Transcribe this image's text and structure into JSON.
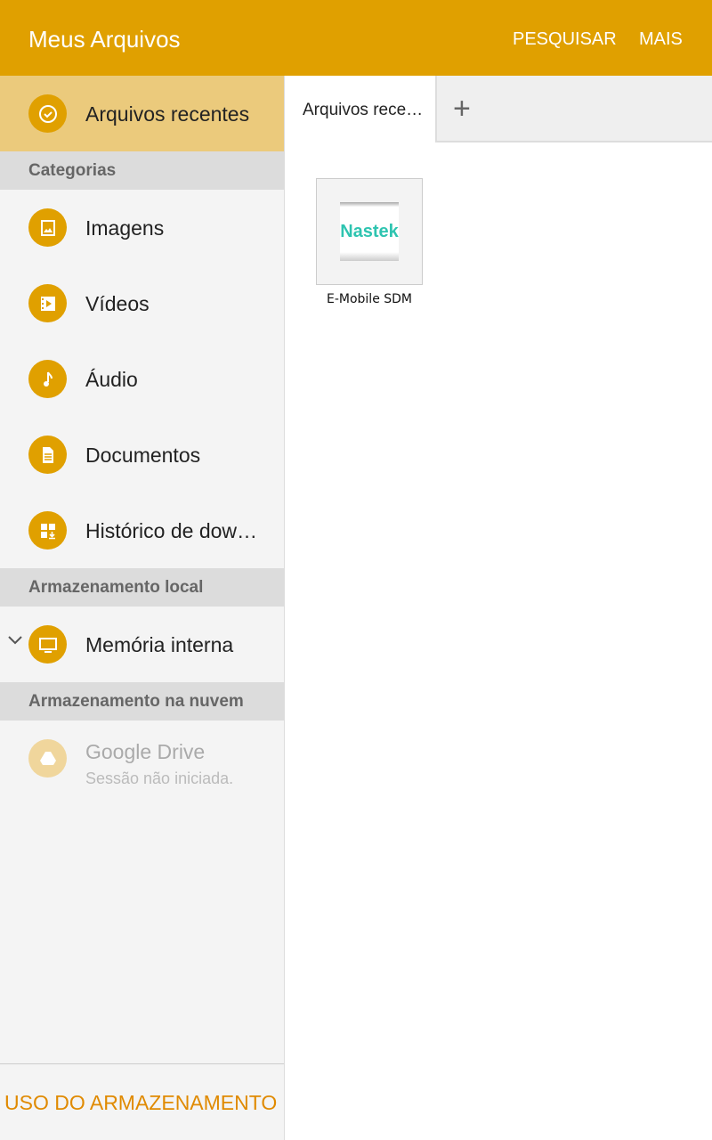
{
  "header": {
    "title": "Meus Arquivos",
    "search": "PESQUISAR",
    "more": "MAIS"
  },
  "sidebar": {
    "recent": "Arquivos recentes",
    "categories_header": "Categorias",
    "categories": [
      "Imagens",
      "Vídeos",
      "Áudio",
      "Documentos",
      "Histórico de dow…"
    ],
    "local_header": "Armazenamento local",
    "internal": "Memória interna",
    "cloud_header": "Armazenamento na nuvem",
    "drive": "Google Drive",
    "drive_status": "Sessão não iniciada.",
    "storage_usage": "USO DO ARMAZENAMENTO"
  },
  "main": {
    "tab": "Arquivos rece…",
    "files": [
      {
        "name": "E-Mobile SDM",
        "logo": "Nastek"
      }
    ]
  },
  "colors": {
    "accent": "#e0a000",
    "selected": "#ebca7c"
  }
}
